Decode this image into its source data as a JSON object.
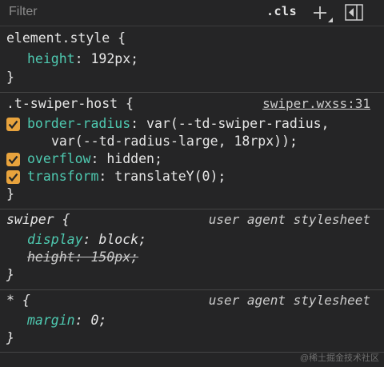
{
  "toolbar": {
    "filter_placeholder": "Filter",
    "cls_label": ".cls",
    "plus_icon": "plus-icon",
    "panel_icon": "toggle-sidebar-icon"
  },
  "rules": {
    "element_style": {
      "selector": "element.style",
      "open": "{",
      "close": "}",
      "prop1": "height",
      "val1": "192px;"
    },
    "swiper_host": {
      "selector": ".t-swiper-host",
      "open": "{",
      "close": "}",
      "source": "swiper.wxss:31",
      "prop1": "border-radius",
      "val1": "var(--td-swiper-radius,",
      "val1_cont": "var(--td-radius-large, 18rpx));",
      "prop2": "overflow",
      "val2": "hidden;",
      "prop3": "transform",
      "val3": "translateY(0);"
    },
    "swiper": {
      "selector": "swiper",
      "open": "{",
      "close": "}",
      "source": "user agent stylesheet",
      "prop1": "display",
      "val1": "block;",
      "prop2": "height",
      "val2": "150px;"
    },
    "universal": {
      "selector": "*",
      "open": "{",
      "close": "}",
      "source": "user agent stylesheet",
      "prop1": "margin",
      "val1": "0;"
    }
  },
  "colors": {
    "background": "#252526",
    "property": "#4ec9b0",
    "checkbox": "#e8a33d"
  },
  "watermark": "@稀土掘金技术社区"
}
